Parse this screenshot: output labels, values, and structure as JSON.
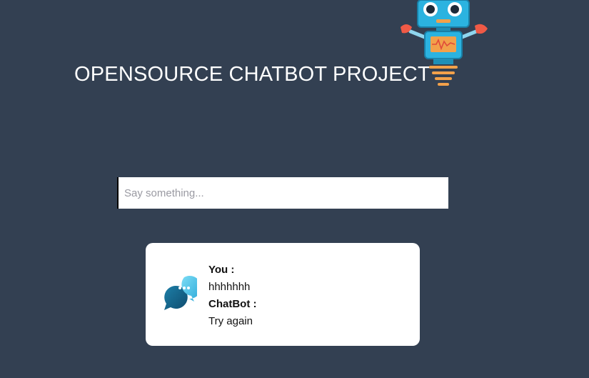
{
  "header": {
    "title": "OPENSOURCE CHATBOT PROJECT",
    "logo_icon": "robot-icon"
  },
  "input": {
    "placeholder": "Say something...",
    "value": ""
  },
  "chat": {
    "icon": "chat-bubbles-icon",
    "user_label": "You :",
    "user_message": "hhhhhhh",
    "bot_label": "ChatBot :",
    "bot_message": "Try again"
  },
  "colors": {
    "background": "#334052",
    "card": "#ffffff",
    "robot_body": "#2bb3e0",
    "robot_accent": "#f05a46"
  }
}
